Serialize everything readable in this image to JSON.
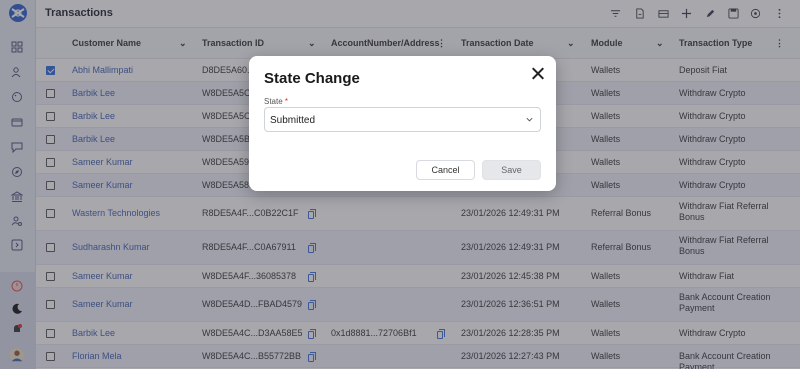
{
  "page": {
    "title": "Transactions"
  },
  "toolbar": {
    "icons": [
      "filter-icon",
      "export-icon",
      "archive-icon",
      "add-icon",
      "edit-icon",
      "save-icon",
      "refresh-icon",
      "more-icon"
    ]
  },
  "table": {
    "columns": [
      "Customer Name",
      "Transaction ID",
      "AccountNumber/Address",
      "Transaction Date",
      "Module",
      "Transaction Type"
    ],
    "rows": [
      {
        "customer": "Abhi Mallimpati",
        "txid": "D8DE5A60...",
        "account": "",
        "date": "",
        "module": "Wallets",
        "type": "Deposit Fiat",
        "checked": true
      },
      {
        "customer": "Barbik Lee",
        "txid": "W8DE5A5C...",
        "account": "",
        "date": "",
        "module": "Wallets",
        "type": "Withdraw Crypto",
        "checked": false
      },
      {
        "customer": "Barbik Lee",
        "txid": "W8DE5A5C...",
        "account": "",
        "date": "",
        "module": "Wallets",
        "type": "Withdraw Crypto",
        "checked": false
      },
      {
        "customer": "Barbik Lee",
        "txid": "W8DE5A5B...",
        "account": "",
        "date": "",
        "module": "Wallets",
        "type": "Withdraw Crypto",
        "checked": false
      },
      {
        "customer": "Sameer Kumar",
        "txid": "W8DE5A59...",
        "account": "",
        "date": "",
        "module": "Wallets",
        "type": "Withdraw Crypto",
        "checked": false
      },
      {
        "customer": "Sameer Kumar",
        "txid": "W8DE5A58...",
        "account": "",
        "date": "",
        "module": "Wallets",
        "type": "Withdraw Crypto",
        "checked": false
      },
      {
        "customer": "Wastern Technologies",
        "txid": "R8DE5A4F...C0B22C1F",
        "account": "",
        "date": "23/01/2026 12:49:31 PM",
        "module": "Referral Bonus",
        "type": "Withdraw Fiat Referral Bonus",
        "checked": false
      },
      {
        "customer": "Sudharashn Kumar",
        "txid": "R8DE5A4F...C0A67911",
        "account": "",
        "date": "23/01/2026 12:49:31 PM",
        "module": "Referral Bonus",
        "type": "Withdraw Fiat Referral Bonus",
        "checked": false
      },
      {
        "customer": "Sameer Kumar",
        "txid": "W8DE5A4F...36085378",
        "account": "",
        "date": "23/01/2026 12:45:38 PM",
        "module": "Wallets",
        "type": "Withdraw Fiat",
        "checked": false
      },
      {
        "customer": "Sameer Kumar",
        "txid": "W8DE5A4D...FBAD4579",
        "account": "",
        "date": "23/01/2026 12:36:51 PM",
        "module": "Wallets",
        "type": "Bank Account Creation Payment",
        "checked": false
      },
      {
        "customer": "Barbik Lee",
        "txid": "W8DE5A4C...D3AA58E5",
        "account": "0x1d8881...72706Bf1",
        "date": "23/01/2026 12:28:35 PM",
        "module": "Wallets",
        "type": "Withdraw Crypto",
        "checked": false
      },
      {
        "customer": "Florian Mela",
        "txid": "W8DE5A4C...B55772BB",
        "account": "",
        "date": "23/01/2026 12:27:43 PM",
        "module": "Wallets",
        "type": "Bank Account Creation Payment",
        "checked": false
      }
    ]
  },
  "dialog": {
    "title": "State Change",
    "field_label": "State",
    "required_mark": "*",
    "selected_value": "Submitted",
    "cancel_label": "Cancel",
    "save_label": "Save"
  },
  "colors": {
    "link": "#3f5fb5",
    "accent": "#2c6ce0",
    "overlay": "rgba(60,60,70,0.45)"
  }
}
